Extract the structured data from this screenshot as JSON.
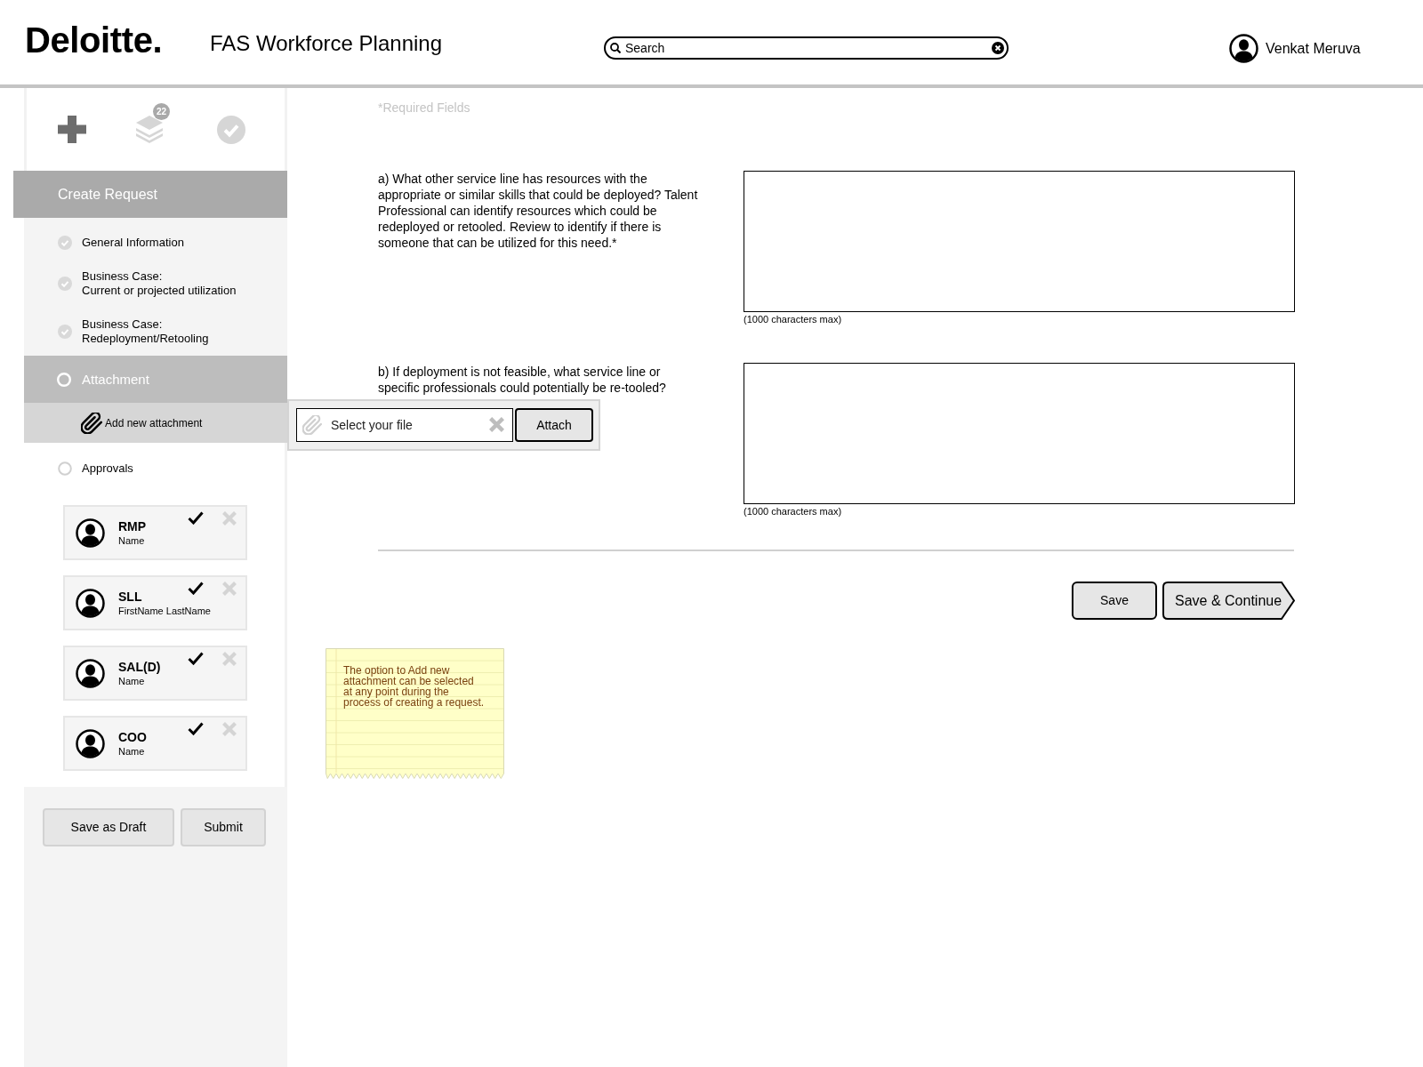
{
  "header": {
    "logo": "Deloitte.",
    "app_title": "FAS Workforce Planning",
    "search": {
      "placeholder": "Search"
    },
    "user": {
      "name": "Venkat Meruva"
    }
  },
  "sidebar": {
    "toolbar": [
      {
        "kind": "add",
        "selected": true
      },
      {
        "kind": "layers",
        "selected": false,
        "badge": "22"
      },
      {
        "kind": "approve",
        "selected": false
      }
    ],
    "section_title": "Create Request",
    "steps": [
      {
        "label": "General Information",
        "completed": true,
        "selected": false
      },
      {
        "label": "Business Case:\nCurrent or projected utilization",
        "completed": true,
        "selected": false
      },
      {
        "label": "Business Case:\nRedeployment/Retooling",
        "completed": true,
        "selected": false
      },
      {
        "label": "Attachment",
        "completed": false,
        "selected": true,
        "action": "Add new attachment"
      },
      {
        "label": "Approvals",
        "completed": false,
        "selected": false,
        "approvers": [
          {
            "role": "RMP",
            "name": "Name",
            "approved": true
          },
          {
            "role": "SLL",
            "name": "FirstName LastName",
            "approved": true
          },
          {
            "role": "SAL(D)",
            "name": "Name",
            "approved": true
          },
          {
            "role": "COO",
            "name": "Name",
            "approved": true
          }
        ]
      }
    ],
    "buttons": [
      "Save as Draft",
      "Submit"
    ]
  },
  "file_picker": {
    "placeholder": "Select your file",
    "button": "Attach"
  },
  "form": {
    "required_note": "*Required Fields",
    "questions": [
      {
        "label": "a) What other service line has resources with the appropriate or similar skills that could be deployed? Talent Professional can identify resources which could be redeployed or retooled. Review to identify if there is someone that can be utilized for this need.*",
        "hint": "(1000 characters max)"
      },
      {
        "label": "b) If deployment is not feasible, what service line or specific professionals could potentially be re-tooled?",
        "hint": "(1000 characters max)"
      }
    ],
    "buttons": [
      {
        "kind": "plain",
        "label": "Save"
      },
      {
        "kind": "next",
        "label": "Save & Continue"
      }
    ]
  },
  "sticky_note": {
    "text": "The option to Add new attachment can be selected at any point during the process of creating a request."
  }
}
